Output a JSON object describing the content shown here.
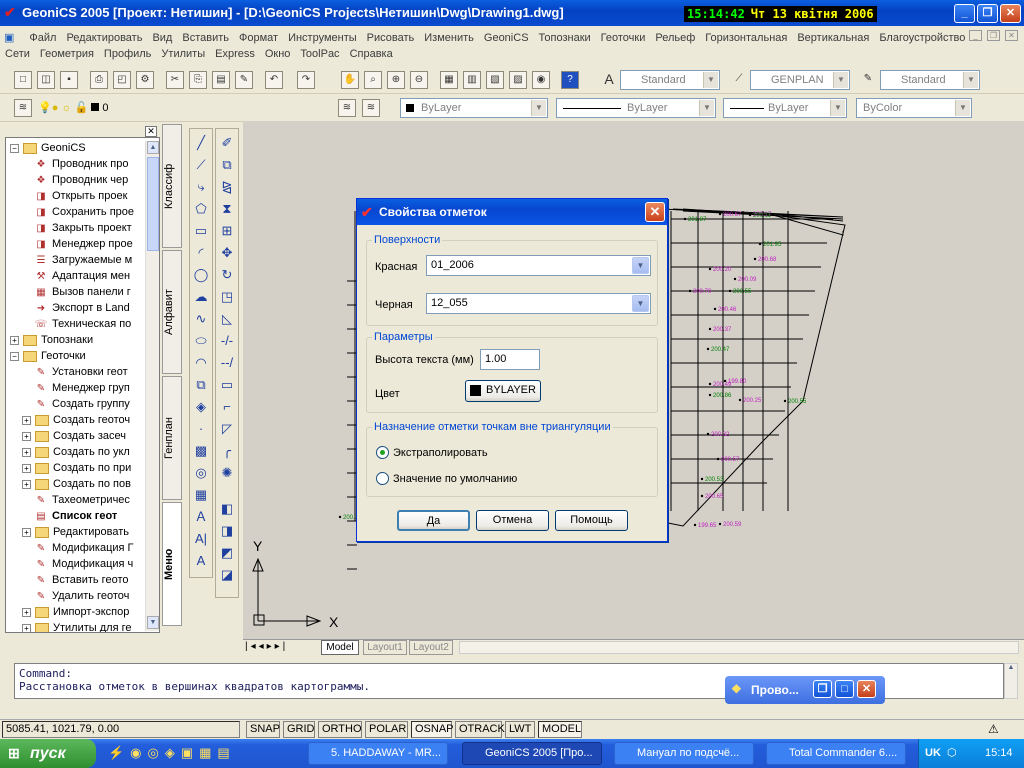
{
  "window": {
    "title": "GeoniCS 2005 [Проект: Нетишин] - [D:\\GeoniCS Projects\\Нетишин\\Dwg\\Drawing1.dwg]",
    "clock_time": "15:14:42",
    "clock_date": "Чт 13 квітня 2006"
  },
  "menu_row1": [
    "Файл",
    "Редактировать",
    "Вид",
    "Вставить",
    "Формат",
    "Инструменты",
    "Рисовать",
    "Изменить",
    "GeoniCS",
    "Топознаки",
    "Геоточки",
    "Рельеф",
    "Горизонтальная",
    "Вертикальная",
    "Благоустройство"
  ],
  "menu_row2": [
    "Сети",
    "Геометрия",
    "Профиль",
    "Утилиты",
    "Express",
    "Окно",
    "ToolPac",
    "Справка"
  ],
  "toolbar": {
    "text_style": "Standard",
    "dim_style": "GENPLAN",
    "table_style": "Standard",
    "layer_value": "0",
    "color": "ByLayer",
    "linetype": "ByLayer",
    "lineweight": "ByLayer",
    "plotstyle": "ByColor"
  },
  "tree": {
    "items": [
      {
        "label": "GeoniCS",
        "level": 0,
        "expander": "−",
        "folder": true
      },
      {
        "label": "Проводник про",
        "level": 2,
        "icon": "❖"
      },
      {
        "label": "Проводник чер",
        "level": 2,
        "icon": "❖"
      },
      {
        "label": "Открыть проек",
        "level": 2,
        "icon": "◨"
      },
      {
        "label": "Сохранить прое",
        "level": 2,
        "icon": "◨"
      },
      {
        "label": "Закрыть проект",
        "level": 2,
        "icon": "◨"
      },
      {
        "label": "Менеджер прое",
        "level": 2,
        "icon": "◨"
      },
      {
        "label": "Загружаемые м",
        "level": 2,
        "icon": "☰"
      },
      {
        "label": "Адаптация мен",
        "level": 2,
        "icon": "⚒"
      },
      {
        "label": "Вызов панели г",
        "level": 2,
        "icon": "▦"
      },
      {
        "label": "Экспорт в Land",
        "level": 2,
        "icon": "➜"
      },
      {
        "label": "Техническая по",
        "level": 2,
        "icon": "☏"
      },
      {
        "label": "Топознаки",
        "level": 0,
        "expander": "+",
        "folder": true
      },
      {
        "label": "Геоточки",
        "level": 0,
        "expander": "−",
        "folder": true
      },
      {
        "label": "Установки геот",
        "level": 2,
        "icon": "✎"
      },
      {
        "label": "Менеджер груп",
        "level": 2,
        "icon": "✎"
      },
      {
        "label": "Создать группу",
        "level": 2,
        "icon": "✎"
      },
      {
        "label": "Создать геоточ",
        "level": 1,
        "expander": "+",
        "folder": true
      },
      {
        "label": "Создать засеч",
        "level": 1,
        "expander": "+",
        "folder": true
      },
      {
        "label": "Создать по укл",
        "level": 1,
        "expander": "+",
        "folder": true
      },
      {
        "label": "Создать по при",
        "level": 1,
        "expander": "+",
        "folder": true
      },
      {
        "label": "Создать по пов",
        "level": 1,
        "expander": "+",
        "folder": true
      },
      {
        "label": "Тахеометричес",
        "level": 2,
        "icon": "✎"
      },
      {
        "label": "Список геот",
        "level": 2,
        "icon": "▤",
        "bold": true
      },
      {
        "label": "Редактировать",
        "level": 1,
        "expander": "+",
        "folder": true
      },
      {
        "label": "Модификация Г",
        "level": 2,
        "icon": "✎"
      },
      {
        "label": "Модификация ч",
        "level": 2,
        "icon": "✎"
      },
      {
        "label": "Вставить геото",
        "level": 2,
        "icon": "✎"
      },
      {
        "label": "Удалить геоточ",
        "level": 2,
        "icon": "✎"
      },
      {
        "label": "Импорт-экспор",
        "level": 1,
        "expander": "+",
        "folder": true
      },
      {
        "label": "Утилиты для ге",
        "level": 1,
        "expander": "+",
        "folder": true
      }
    ]
  },
  "side_tabs": [
    "Классиф",
    "Алфавит",
    "Генплан",
    "Меню"
  ],
  "canvas": {
    "y_axis": "Y",
    "x_axis": "X",
    "point_labels": [
      "201.87",
      "200.67",
      "200.17",
      "201.95",
      "200.20",
      "200.68",
      "200.55",
      "200.70",
      "200.46",
      "200.47",
      "199.80",
      "200.49",
      "200.86",
      "200.25",
      "200.32",
      "200.53",
      "200.65",
      "199.65",
      "200.11",
      "200.37",
      "200.09",
      "200.55",
      "200.57",
      "200.59",
      "200.72"
    ]
  },
  "layout_tabs": [
    "Model",
    "Layout1",
    "Layout2"
  ],
  "command": {
    "line1": "Command:",
    "line2": "Расстановка отметок в вершинах квадратов картограммы."
  },
  "float_window": "Прово...",
  "status": {
    "coords": "5085.41, 1021.79, 0.00",
    "buttons": [
      "SNAP",
      "GRID",
      "ORTHO",
      "POLAR",
      "OSNAP",
      "OTRACK",
      "LWT",
      "MODEL"
    ]
  },
  "taskbar": {
    "start": "пуск",
    "tasks": [
      "5. HADDAWAY - MR...",
      "GeoniCS 2005 [Про...",
      "Мануал по подсчё...",
      "Total Commander 6...."
    ],
    "lang": "UK",
    "time": "15:14"
  },
  "dialog": {
    "title": "Свойства отметок",
    "surfaces_group": "Поверхности",
    "red_label": "Красная",
    "red_value": "01_2006",
    "black_label": "Черная",
    "black_value": "12_055",
    "params_group": "Параметры",
    "text_height_label": "Высота текста (мм)",
    "text_height_value": "1.00",
    "color_label": "Цвет",
    "color_value": "BYLAYER",
    "outside_group": "Назначение отметки точкам вне триангуляции",
    "radio_extrapolate": "Экстраполировать",
    "radio_default": "Значение по умолчанию",
    "ok": "Да",
    "cancel": "Отмена",
    "help": "Помощь"
  }
}
